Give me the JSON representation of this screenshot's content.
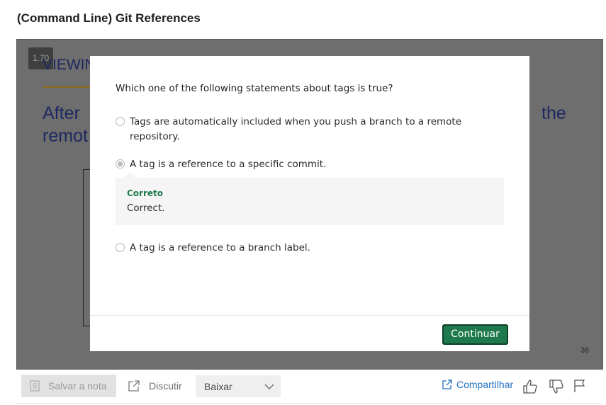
{
  "page": {
    "title": "(Command Line) Git References"
  },
  "video": {
    "speed": "1.70",
    "slide": {
      "heading": "VIEWIN",
      "line1": "After",
      "line1_end": "the",
      "line2": "remot",
      "page_number": "36"
    }
  },
  "quiz": {
    "question": "Which one of the following statements about tags is true?",
    "options": [
      {
        "label": "Tags are automatically included when you push a branch to a remote repository.",
        "selected": false
      },
      {
        "label": "A tag is a reference to a specific commit.",
        "selected": true
      },
      {
        "label": "A tag is a reference to a branch label.",
        "selected": false
      }
    ],
    "feedback": {
      "status": "Correto",
      "text": "Correct."
    },
    "continue_label": "Continuar",
    "accent_color": "#1e7a4c"
  },
  "toolbar": {
    "save_note_label": "Salvar a nota",
    "discuss_label": "Discutir",
    "download_label": "Baixar",
    "share_label": "Compartilhar",
    "icons": [
      "note-icon",
      "external-link-icon",
      "chevron-down-icon",
      "share-icon",
      "thumb-up-icon",
      "thumb-down-icon",
      "flag-icon"
    ]
  }
}
